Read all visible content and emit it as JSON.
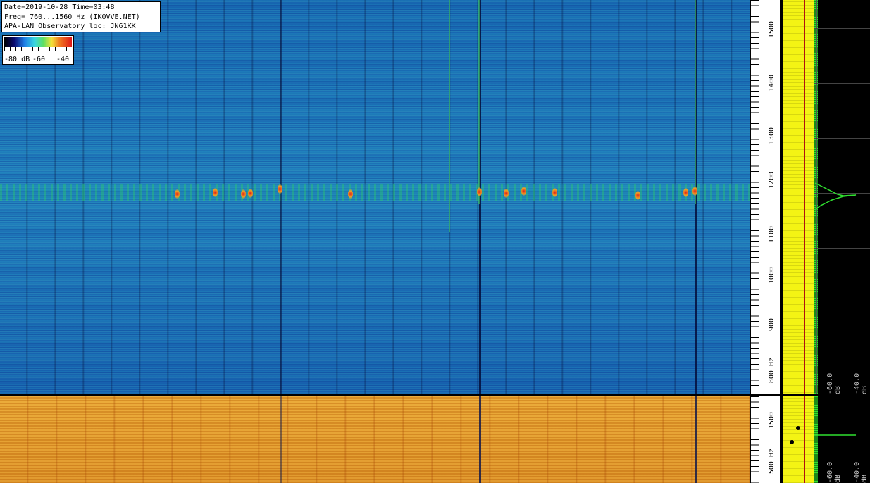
{
  "info": {
    "line1": "Date=2019-10-28 Time=03:48",
    "line2": "Freq= 760...1560 Hz (IK0VVE.NET)",
    "line3": "APA-LAN Observatory loc: JN61KK"
  },
  "scale": {
    "label_left": "-80 dB",
    "label_mid": "-60",
    "label_right": "-40"
  },
  "freq_axis_top": {
    "labels": [
      "1500",
      "1400",
      "1300",
      "1200",
      "1100",
      "1000",
      "900",
      "800 Hz"
    ]
  },
  "freq_axis_bottom": {
    "labels": [
      "1500",
      "500 Hz"
    ]
  },
  "spectrum_top": {
    "db_labels": [
      "-60.0 dB",
      "-40.0 dB"
    ]
  },
  "spectrum_bottom": {
    "db_labels": [
      "-60.0 dB",
      "-40.0 dB"
    ]
  },
  "colors": {
    "waterfall_top": "#2a87c0",
    "waterfall_bottom": "#d98c28",
    "spectrum_avg": "#f4f414",
    "spectrum_peak": "#30e030",
    "time_label": "#c01818"
  }
}
